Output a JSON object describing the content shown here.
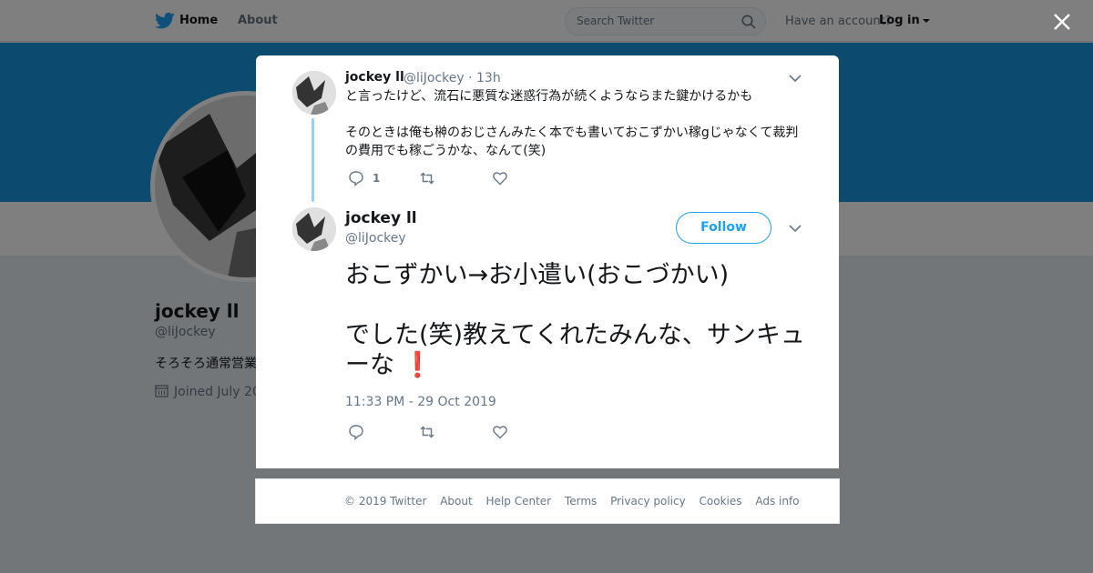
{
  "topbar": {
    "home_label": "Home",
    "about_label": "About",
    "search_placeholder": "Search Twitter",
    "have_account": "Have an account?",
    "login_label": "Log in"
  },
  "profile": {
    "name": "jockey ll",
    "handle": "@liJockey",
    "bio_preview": "そろそろ通常営業",
    "joined_preview": "Joined July 20"
  },
  "colors": {
    "accent": "#1da1f2",
    "banner": "#1b95e0",
    "thread_line": "#9ad0f5",
    "exclaim": "#c0152b"
  },
  "parent_tweet": {
    "name": "jockey ll",
    "meta": "@liJockey · 13h",
    "text": "と言ったけど、流石に悪質な迷惑行為が続くようならまた鍵かけるかも\n\nそのときは俺も榊のおじさんみたく本でも書いておこずかい稼gじゃなくて裁判の費用でも稼ごうかな、なんて(笑)",
    "reply_count": "1"
  },
  "main_tweet": {
    "name": "jockey ll",
    "handle": "@liJockey",
    "follow_label": "Follow",
    "text": "おこずかい→お小遣い(おこづかい)\n\nでした(笑)教えてくれたみんな、サンキューな",
    "emoji": "❗",
    "timestamp": "11:33 PM - 29 Oct 2019"
  },
  "footer": {
    "copyright": "© 2019 Twitter",
    "links": [
      "About",
      "Help Center",
      "Terms",
      "Privacy policy",
      "Cookies",
      "Ads info"
    ]
  }
}
